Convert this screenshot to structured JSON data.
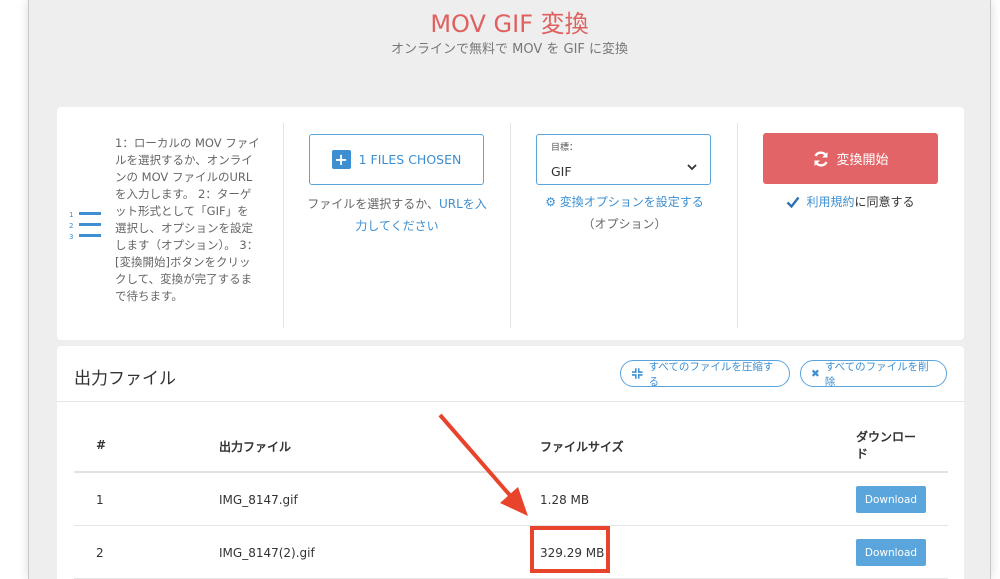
{
  "header": {
    "title": "MOV GIF 変換",
    "subtitle": "オンラインで無料で MOV を GIF に変換"
  },
  "steps": {
    "icon": "numbered-list-icon",
    "text": "1：ローカルの MOV ファイルを選択するか、オンラインの MOV ファイルのURLを入力します。 2：ターゲット形式として「GIF」を選択し、オプションを設定します（オプション）。 3：[変換開始]ボタンをクリックして、変換が完了するまで待ちます。"
  },
  "upload": {
    "button_label": "1 FILES CHOSEN",
    "help_prefix": "ファイルを選択するか、",
    "help_link": "URLを入力してください"
  },
  "target": {
    "label": "目標：",
    "value": "GIF",
    "options_link": "変換オプションを設定する",
    "options_note": "（オプション）"
  },
  "convert": {
    "button_label": "変換開始",
    "terms_link": "利用規約",
    "terms_suffix": "に同意する",
    "accent": "#e36466"
  },
  "output": {
    "title": "出力ファイル",
    "compress_all": "すべてのファイルを圧縮する",
    "delete_all": "すべてのファイルを削除",
    "columns": {
      "index": "#",
      "file": "出力ファイル",
      "size": "ファイルサイズ",
      "download": "ダウンロード"
    },
    "rows": [
      {
        "index": "1",
        "file": "IMG_8147.gif",
        "size": "1.28 MB",
        "download": "Download"
      },
      {
        "index": "2",
        "file": "IMG_8147(2).gif",
        "size": "329.29 MB",
        "download": "Download"
      }
    ]
  },
  "annotation": {
    "color": "#e8442c"
  }
}
